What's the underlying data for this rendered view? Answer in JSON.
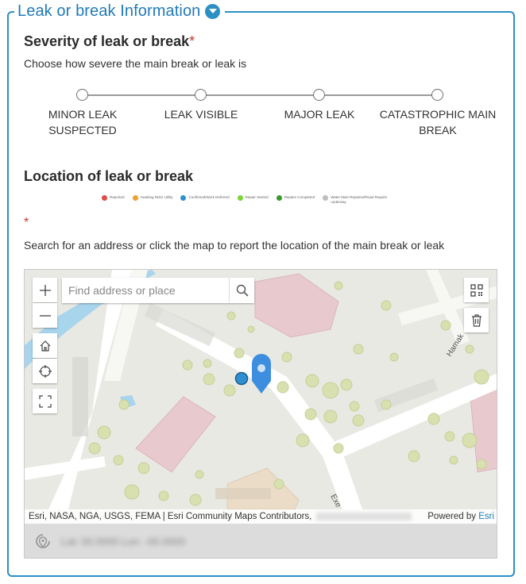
{
  "section": {
    "title": "Leak or break Information"
  },
  "severity": {
    "title": "Severity of leak or break",
    "required_mark": "*",
    "description": "Choose how severe the main break or leak is",
    "options": [
      {
        "line1": "MINOR LEAK",
        "line2": "SUSPECTED"
      },
      {
        "line1": "LEAK VISIBLE",
        "line2": ""
      },
      {
        "line1": "MAJOR LEAK",
        "line2": ""
      },
      {
        "line1": "CATASTROPHIC MAIN",
        "line2": "BREAK"
      }
    ]
  },
  "location": {
    "title": "Location of leak or break",
    "legend": [
      {
        "label": "Reported",
        "color": "#e04b4b"
      },
      {
        "label": "Awaiting NISS Utility",
        "color": "#f0a030"
      },
      {
        "label": "Confirmed/Work Deferred",
        "color": "#2f8fd0"
      },
      {
        "label": "Repair Started",
        "color": "#7bd43c"
      },
      {
        "label": "Repairs Completed",
        "color": "#3a9a2a"
      },
      {
        "label": "Water Main Repaired/Road Repairs underway",
        "color": "#bdbdbd"
      }
    ],
    "required_mark": "*",
    "description": "Search for an address or click the map to report the location of the main break or leak"
  },
  "map": {
    "search_placeholder": "Find address or place",
    "attribution": "Esri, NASA, NGA, USGS, FEMA | Esri Community Maps Contributors,",
    "powered_by": "Powered by",
    "esri": "Esri",
    "street_labels": [
      "Hamak",
      "Exe"
    ],
    "coordinates": "Lat: 00.0000 Lon: -00.0000"
  }
}
